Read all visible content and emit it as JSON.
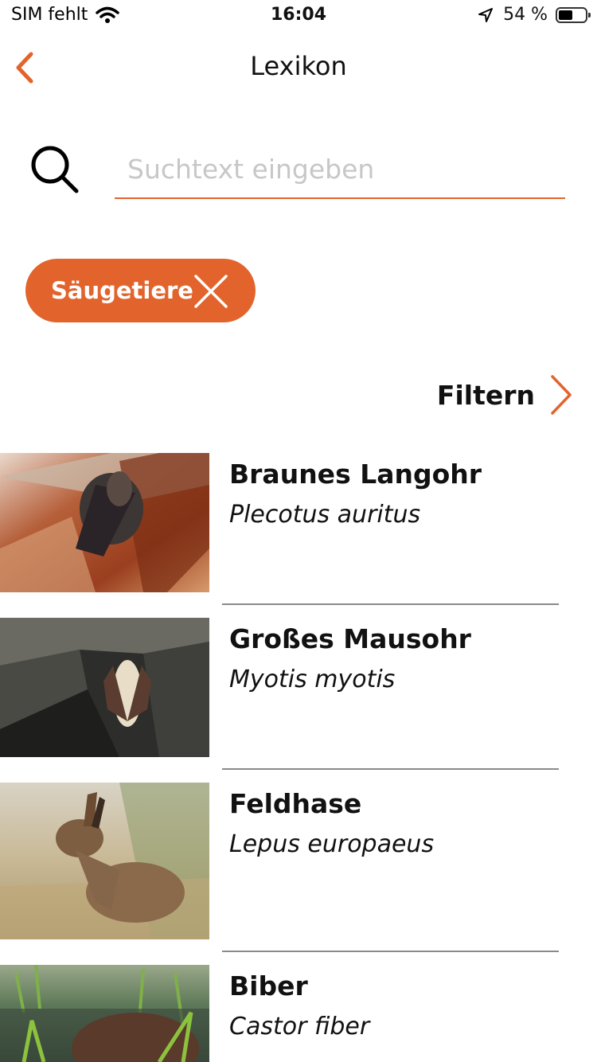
{
  "status_bar": {
    "carrier": "SIM fehlt",
    "time": "16:04",
    "battery_percent": "54 %",
    "battery_level": 0.54
  },
  "nav": {
    "title": "Lexikon",
    "back_icon": "chevron-left-icon"
  },
  "search": {
    "placeholder": "Suchtext eingeben",
    "value": "",
    "icon": "search-icon"
  },
  "active_filter_chip": {
    "label": "Säugetiere",
    "close_icon": "close-icon"
  },
  "filter_link": {
    "label": "Filtern",
    "icon": "chevron-right-icon"
  },
  "species": [
    {
      "common_name": "Braunes Langohr",
      "latin_name": "Plecotus auritus",
      "image": "bat-hanging-on-bark"
    },
    {
      "common_name": "Großes Mausohr",
      "latin_name": "Myotis myotis",
      "image": "bat-under-rock"
    },
    {
      "common_name": "Feldhase",
      "latin_name": "Lepus europaeus",
      "image": "hare-in-grass"
    },
    {
      "common_name": "Biber",
      "latin_name": "Castor fiber",
      "image": "beaver-in-water"
    }
  ],
  "colors": {
    "accent": "#e2642c",
    "separator": "#8a8a8a",
    "placeholder": "#c7c7c7"
  }
}
